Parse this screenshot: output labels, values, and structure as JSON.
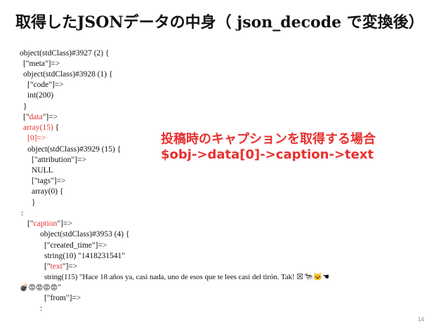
{
  "slide": {
    "title": "取得したJSONデータの中身（ json_decode で変換後）",
    "page_number": "14"
  },
  "annotation": {
    "line1": "投稿時のキャプションを取得する場合",
    "line2": "$obj->data[0]->caption->text"
  },
  "code": {
    "l1": "object(stdClass)#3927 (2) {",
    "l2": "[\"meta\"]=>",
    "l3": "object(stdClass)#3928 (1) {",
    "l4": "[\"code\"]=>",
    "l5": "int(200)",
    "l6": "}",
    "l7_pre": "[\"",
    "l7_key": "data",
    "l7_post": "\"]=>",
    "l8_red": "array(15)",
    "l8_post": " {",
    "l9": "[0]=>",
    "l10": "object(stdClass)#3929 (15) {",
    "l11": "[\"attribution\"]=>",
    "l12": "NULL",
    "l13": "[\"tags\"]=>",
    "l14": "array(0) {",
    "l15": "}",
    "l16": ":",
    "l17_pre": "[\"",
    "l17_key": "caption",
    "l17_post": "\"]=>",
    "l18": "object(stdClass)#3953 (4) {",
    "l19": "[\"created_time\"]=>",
    "l20": "string(10) \"1418231541\"",
    "l21_pre": "[\"",
    "l21_key": "text",
    "l21_post": "\"]=>",
    "l22": "string(115) \"Hace 18 años ya, casi nada, uno de esos que te lees casi del tirón. Tak! ☒🐄🐱☚",
    "l23_emoji": "💣😡😡😡😡",
    "l23_post": "\"",
    "l24": "[\"from\"]=>",
    "l25": ":"
  }
}
